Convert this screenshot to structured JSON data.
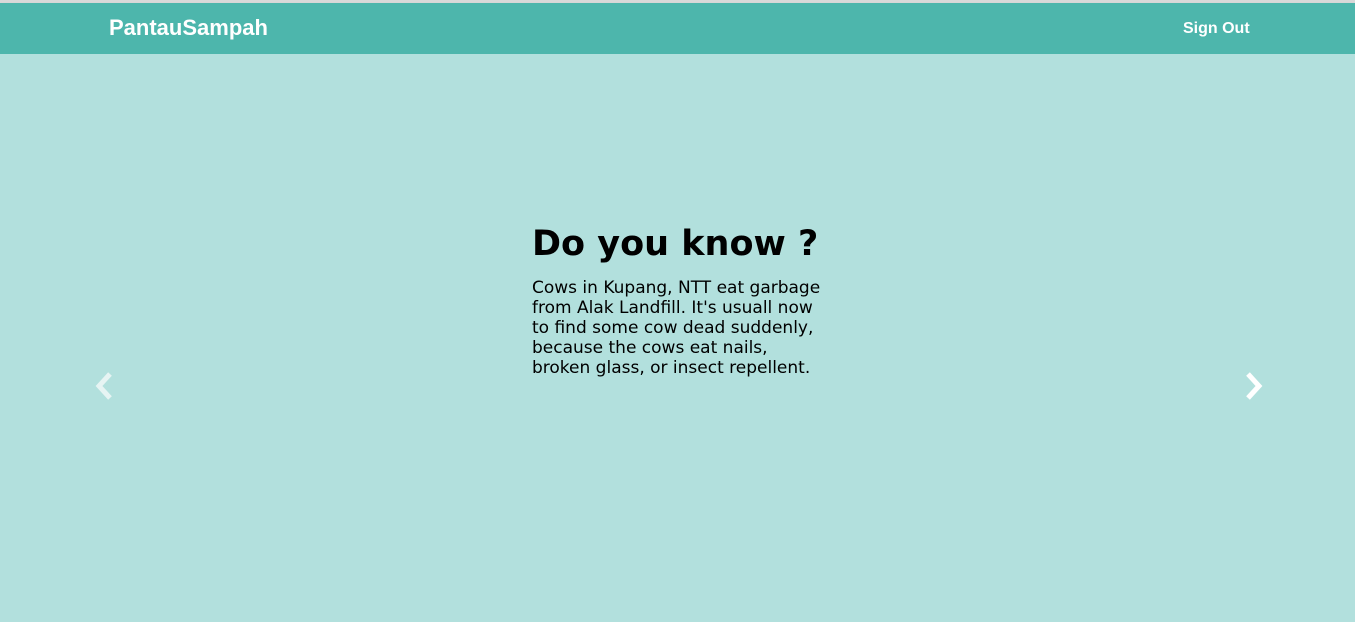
{
  "navbar": {
    "brand": "PantauSampah",
    "sign_out_label": "Sign Out"
  },
  "carousel": {
    "slide": {
      "title": "Do you know ?",
      "text": "Cows in Kupang, NTT eat garbage from Alak Landfill. It's usuall now to find some cow dead suddenly, because the cows eat nails, broken glass, or insect repellent."
    },
    "prev_icon": "chevron-left-icon",
    "next_icon": "chevron-right-icon"
  },
  "colors": {
    "navbar_bg": "#4db6ac",
    "page_bg": "#b2e0dd",
    "text": "#000000",
    "nav_text": "#ffffff"
  }
}
